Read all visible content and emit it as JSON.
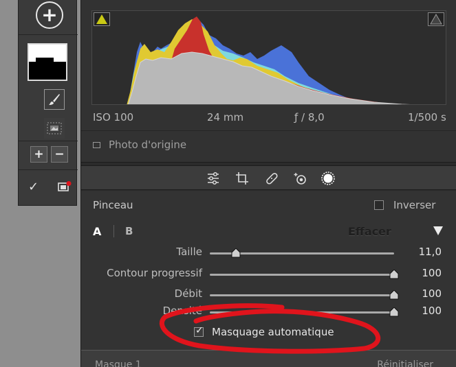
{
  "left_toolbar": {
    "add_mask_label": "+",
    "add_brush_label": "+",
    "subtract_brush_label": "−",
    "show_overlay_check": "✓"
  },
  "histogram": {
    "exif": {
      "iso": "ISO 100",
      "focal_length": "24 mm",
      "aperture": "ƒ / 8,0",
      "shutter": "1/500 s"
    },
    "original_photo_label": "Photo d'origine"
  },
  "brush": {
    "title": "Pinceau",
    "invert_label": "Inverser",
    "tab_a": "A",
    "tab_b": "B",
    "erase_label": "Effacer",
    "sliders": [
      {
        "label": "Taille",
        "value": "11,0",
        "fraction": 0.14
      },
      {
        "label": "Contour progressif",
        "value": "100",
        "fraction": 1.0
      },
      {
        "label": "Débit",
        "value": "100",
        "fraction": 1.0
      },
      {
        "label": "Densité",
        "value": "100",
        "fraction": 1.0
      }
    ],
    "auto_mask_label": "Masquage automatique",
    "auto_mask_checked": true
  },
  "footer": {
    "mask_name": "Masque 1",
    "reset_label": "Réinitialiser"
  },
  "colors": {
    "annotation_red": "#e0141c",
    "histogram_blue": "#4a72d8",
    "histogram_yellow": "#e0c932",
    "histogram_red": "#c8312c",
    "histogram_gray": "#b8b8b8"
  }
}
